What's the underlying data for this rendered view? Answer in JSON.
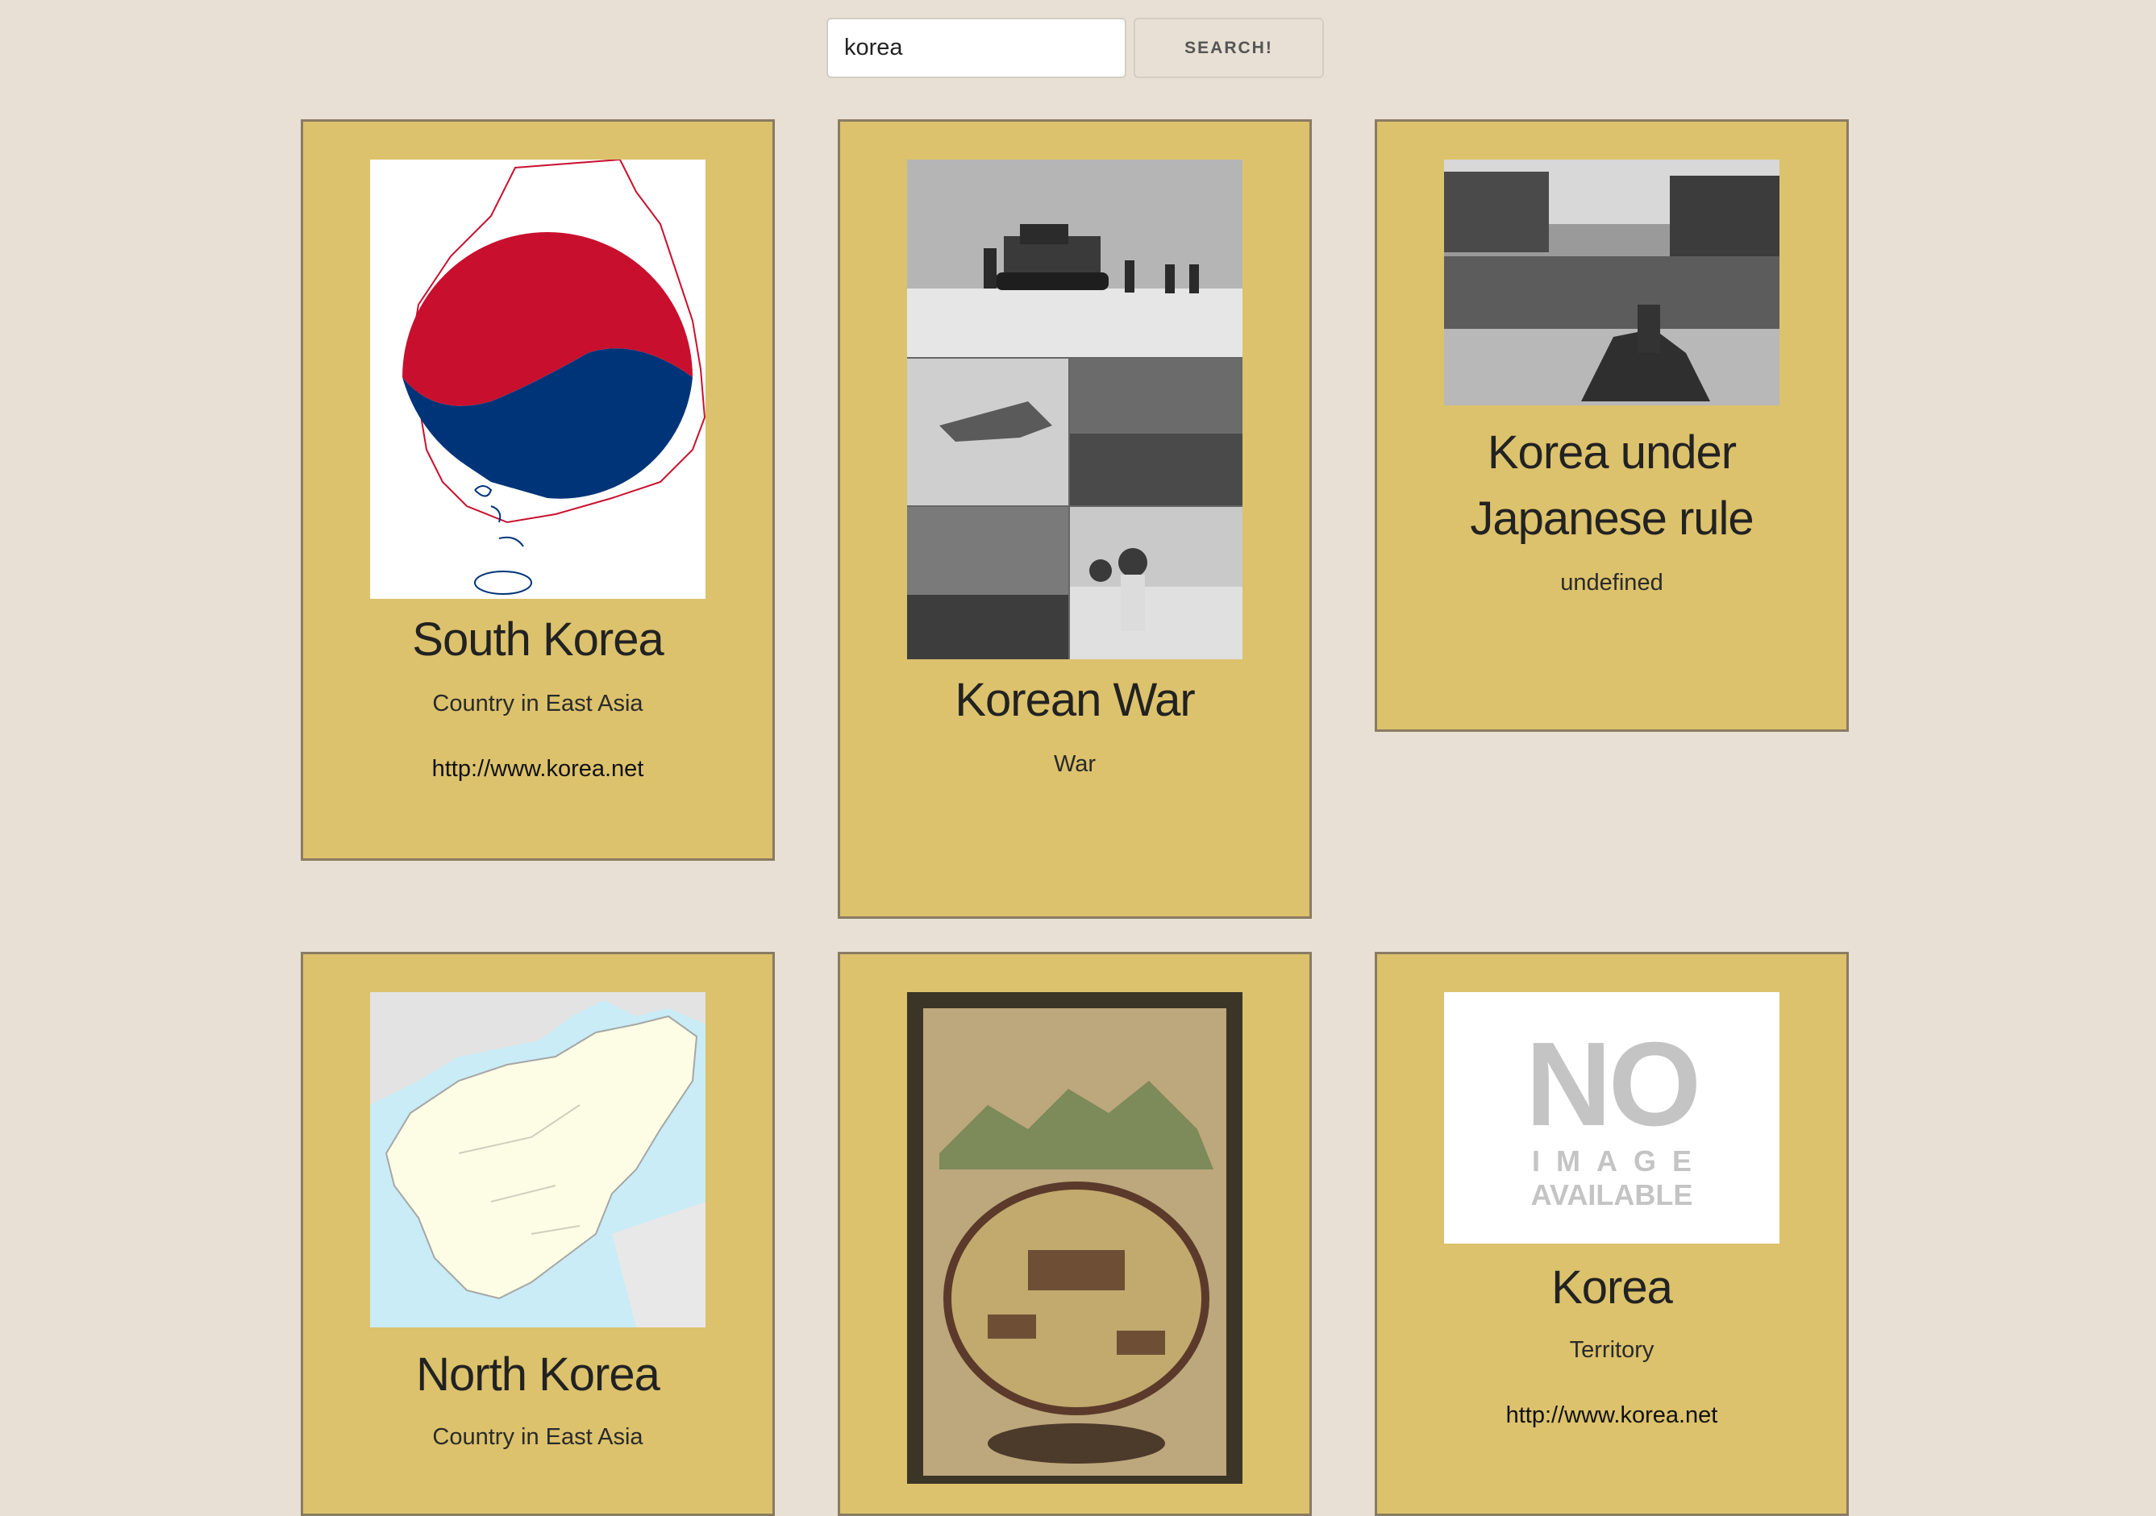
{
  "search": {
    "value": "korea",
    "button_label": "SEARCH!"
  },
  "cards": [
    {
      "title": "South Korea",
      "description": "Country in East Asia",
      "link": "http://www.korea.net",
      "image": "south-korea-flag-map"
    },
    {
      "title": "Korean War",
      "description": "War",
      "image": "korean-war-photo-collage"
    },
    {
      "title": "Korea under Japanese rule",
      "description": "undefined",
      "image": "japanese-rule-crowd-photo"
    },
    {
      "title": "North Korea",
      "description": "Country in East Asia",
      "image": "north-korea-locator-map"
    },
    {
      "title": "",
      "description": "",
      "image": "korean-fortress-painting"
    },
    {
      "title": "Korea",
      "description": "Territory",
      "link": "http://www.korea.net",
      "image": "no-image-placeholder",
      "placeholder_text": {
        "line1": "NO",
        "line2": "IMAGE",
        "line3": "AVAILABLE"
      }
    }
  ],
  "colors": {
    "page_background": "#e8e0d4",
    "card_background": "#dcc26c",
    "card_border": "#8a7b63",
    "flag_red": "#c8102e",
    "flag_blue": "#003478"
  }
}
